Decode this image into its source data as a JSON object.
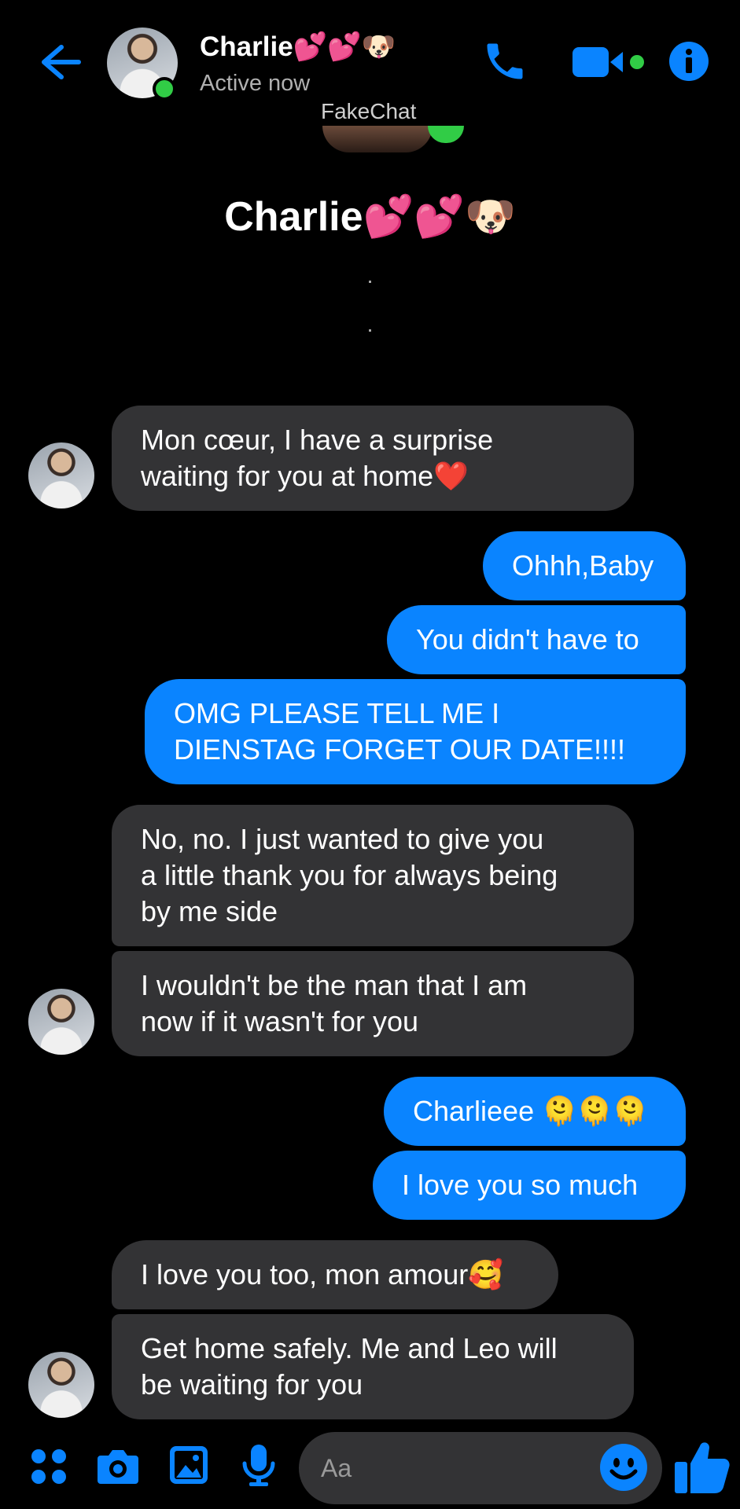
{
  "header": {
    "contact_name": "Charlie💕💕🐶",
    "status": "Active now",
    "watermark": "FakeChat"
  },
  "profile": {
    "name": "Charlie💕💕🐶",
    "dot1": ".",
    "dot2": "."
  },
  "messages": [
    {
      "side": "in",
      "text": "Mon cœur, I have a surprise\nwaiting for you at home❤️"
    },
    {
      "side": "out",
      "text": "Ohhh,Baby"
    },
    {
      "side": "out",
      "text": "You didn't have to"
    },
    {
      "side": "out",
      "text": "OMG PLEASE TELL ME I\nDIENSTAG FORGET OUR DATE!!!!"
    },
    {
      "side": "in",
      "text": "No, no. I just wanted to give you\na little thank you for always being\nby me side"
    },
    {
      "side": "in",
      "text": "I wouldn't be the man that I am\nnow if it wasn't for you"
    },
    {
      "side": "out",
      "text": "Charlieee 🫠🫠🫠"
    },
    {
      "side": "out",
      "text": "I love you so much"
    },
    {
      "side": "in",
      "text": "I love you too, mon amour🥰"
    },
    {
      "side": "in",
      "text": "Get home safely.  Me and Leo will\nbe waiting for you"
    }
  ],
  "composer": {
    "placeholder": "Aa"
  },
  "colors": {
    "accent": "#0a84ff",
    "incoming_bubble": "#333335",
    "online": "#31cc46"
  },
  "icons": [
    "back-arrow-icon",
    "phone-icon",
    "video-camera-icon",
    "info-icon",
    "apps-icon",
    "camera-icon",
    "photo-icon",
    "microphone-icon",
    "emoji-icon",
    "thumbs-up-icon"
  ]
}
